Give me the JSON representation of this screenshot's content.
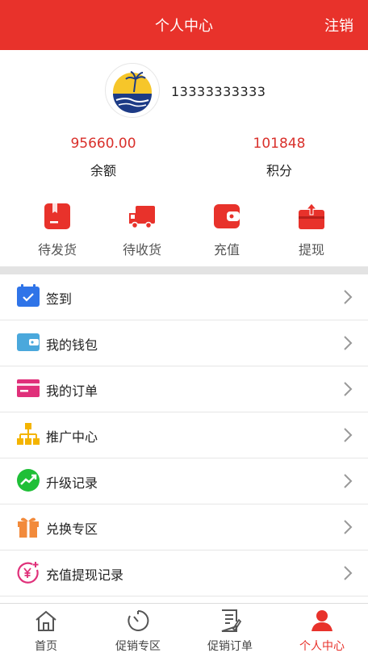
{
  "header": {
    "title": "个人中心",
    "logout_label": "注销"
  },
  "profile": {
    "phone": "13333333333",
    "balance": {
      "value": "95660.00",
      "label": "余额"
    },
    "points": {
      "value": "101848",
      "label": "积分"
    }
  },
  "quick_actions": [
    {
      "label": "待发货",
      "icon": "pending-shipment-icon"
    },
    {
      "label": "待收货",
      "icon": "delivery-truck-icon"
    },
    {
      "label": "充值",
      "icon": "wallet-icon"
    },
    {
      "label": "提现",
      "icon": "withdraw-icon"
    }
  ],
  "menu": [
    {
      "label": "签到",
      "icon": "calendar-check-icon"
    },
    {
      "label": "我的钱包",
      "icon": "wallet-icon"
    },
    {
      "label": "我的订单",
      "icon": "card-icon"
    },
    {
      "label": "推广中心",
      "icon": "org-chart-icon"
    },
    {
      "label": "升级记录",
      "icon": "trend-up-icon"
    },
    {
      "label": "兑换专区",
      "icon": "gift-icon"
    },
    {
      "label": "充值提现记录",
      "icon": "yuan-icon"
    }
  ],
  "tabbar": [
    {
      "label": "首页",
      "icon": "home-icon",
      "active": false
    },
    {
      "label": "促销专区",
      "icon": "timer-icon",
      "active": false
    },
    {
      "label": "促销订单",
      "icon": "order-list-icon",
      "active": false
    },
    {
      "label": "个人中心",
      "icon": "user-icon",
      "active": true
    }
  ],
  "colors": {
    "brand": "#e8322b",
    "text": "#222222",
    "divider": "#e3e3e3"
  }
}
